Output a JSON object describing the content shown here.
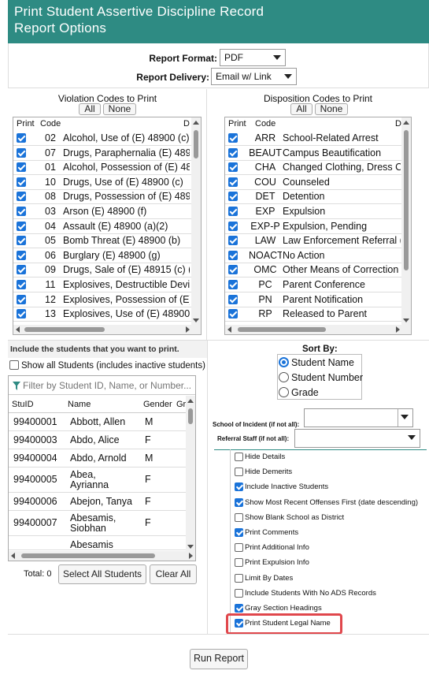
{
  "header": {
    "title_line1": "Print Student Assertive Discipline Record",
    "title_line2": "Report Options"
  },
  "report": {
    "format_label": "Report Format:",
    "format_value": "PDF",
    "delivery_label": "Report Delivery:",
    "delivery_value": "Email w/ Link"
  },
  "violations": {
    "title": "Violation Codes to Print",
    "all_label": "All",
    "none_label": "None",
    "col_print": "Print",
    "col_code": "Code",
    "col_desc": "D",
    "rows": [
      {
        "code": "02",
        "desc": "Alcohol, Use of (E) 48900 (c)",
        "checked": true
      },
      {
        "code": "07",
        "desc": "Drugs, Paraphernalia (E) 489",
        "checked": true
      },
      {
        "code": "01",
        "desc": "Alcohol, Possession of (E) 489",
        "checked": true
      },
      {
        "code": "10",
        "desc": "Drugs, Use of (E) 48900 (c)",
        "checked": true
      },
      {
        "code": "08",
        "desc": "Drugs, Possession of (E) 4891",
        "checked": true
      },
      {
        "code": "03",
        "desc": "Arson (E) 48900 (f)",
        "checked": true
      },
      {
        "code": "04",
        "desc": "Assault (E) 48900 (a)(2)",
        "checked": true
      },
      {
        "code": "05",
        "desc": "Bomb Threat (E) 48900 (b)",
        "checked": true
      },
      {
        "code": "06",
        "desc": "Burglary (E) 48900 (g)",
        "checked": true
      },
      {
        "code": "09",
        "desc": "Drugs, Sale of (E) 48915 (c) (3",
        "checked": true
      },
      {
        "code": "11",
        "desc": "Explosives, Destructible Devic",
        "checked": true
      },
      {
        "code": "12",
        "desc": "Explosives, Possession of (E) 4",
        "checked": true
      },
      {
        "code": "13",
        "desc": "Explosives, Use of (E) 48900 (",
        "checked": true
      }
    ]
  },
  "dispositions": {
    "title": "Disposition Codes to Print",
    "all_label": "All",
    "none_label": "None",
    "col_print": "Print",
    "col_code": "Code",
    "col_desc": "D",
    "rows": [
      {
        "code": "ARR",
        "desc": "School-Related Arrest",
        "checked": true
      },
      {
        "code": "BEAUT",
        "desc": "Campus Beautification",
        "checked": true
      },
      {
        "code": "CHA",
        "desc": "Changed Clothing, Dress Co",
        "checked": true
      },
      {
        "code": "COU",
        "desc": "Counseled",
        "checked": true
      },
      {
        "code": "DET",
        "desc": "Detention",
        "checked": true
      },
      {
        "code": "EXP",
        "desc": "Expulsion",
        "checked": true
      },
      {
        "code": "EXP-P",
        "desc": "Expulsion, Pending",
        "checked": true
      },
      {
        "code": "LAW",
        "desc": "Law Enforcement Referral (",
        "checked": true
      },
      {
        "code": "NOACT",
        "desc": "No Action",
        "checked": true
      },
      {
        "code": "OMC",
        "desc": "Other Means of Correction",
        "checked": true
      },
      {
        "code": "PC",
        "desc": "Parent Conference",
        "checked": true
      },
      {
        "code": "PN",
        "desc": "Parent Notification",
        "checked": true
      },
      {
        "code": "RP",
        "desc": "Released to Parent",
        "checked": true
      }
    ]
  },
  "students": {
    "include_label": "Include the students that you want to print.",
    "show_all_label": "Show all Students (includes inactive students)",
    "filter_placeholder": "Filter by Student ID, Name, or Number...",
    "col_id": "StuID",
    "col_name": "Name",
    "col_gender": "Gender",
    "col_gr": "Gr",
    "rows": [
      {
        "id": "99400001",
        "name": "Abbott, Allen",
        "gender": "M"
      },
      {
        "id": "99400003",
        "name": "Abdo, Alice",
        "gender": "F"
      },
      {
        "id": "99400004",
        "name": "Abdo, Arnold",
        "gender": "M"
      },
      {
        "id": "99400005",
        "name": "Abea,\nAyrianna",
        "gender": "F"
      },
      {
        "id": "99400006",
        "name": "Abejon, Tanya",
        "gender": "F"
      },
      {
        "id": "99400007",
        "name": "Abesamis,\nSiobhan",
        "gender": "F"
      },
      {
        "id": "",
        "name": "Abesamis",
        "gender": ""
      }
    ],
    "total_label": "Total: 0",
    "select_all_label": "Select All Students",
    "clear_all_label": "Clear All"
  },
  "sort": {
    "title": "Sort By:",
    "options": [
      {
        "label": "Student Name",
        "selected": true
      },
      {
        "label": "Student Number",
        "selected": false
      },
      {
        "label": "Grade",
        "selected": false
      }
    ],
    "school_label": "School of Incident (if not all):",
    "staff_label": "Referral Staff (if not all):"
  },
  "options": [
    {
      "label": "Hide Details",
      "checked": false
    },
    {
      "label": "Hide Demerits",
      "checked": false
    },
    {
      "label": "Include Inactive Students",
      "checked": true
    },
    {
      "label": "Show Most Recent Offenses First (date descending)",
      "checked": true
    },
    {
      "label": "Show Blank School as District",
      "checked": false
    },
    {
      "label": "Print Comments",
      "checked": true
    },
    {
      "label": "Print Additional Info",
      "checked": false
    },
    {
      "label": "Print Expulsion Info",
      "checked": false
    },
    {
      "label": "Limit By Dates",
      "checked": false
    },
    {
      "label": "Include Students With No ADS Records",
      "checked": false
    },
    {
      "label": "Gray Section Headings",
      "checked": true
    },
    {
      "label": "Print Student Legal Name",
      "checked": true
    }
  ],
  "run_label": "Run Report",
  "colors": {
    "header": "#2e8b83",
    "check": "#1a73d9",
    "highlight": "#e0474c"
  }
}
